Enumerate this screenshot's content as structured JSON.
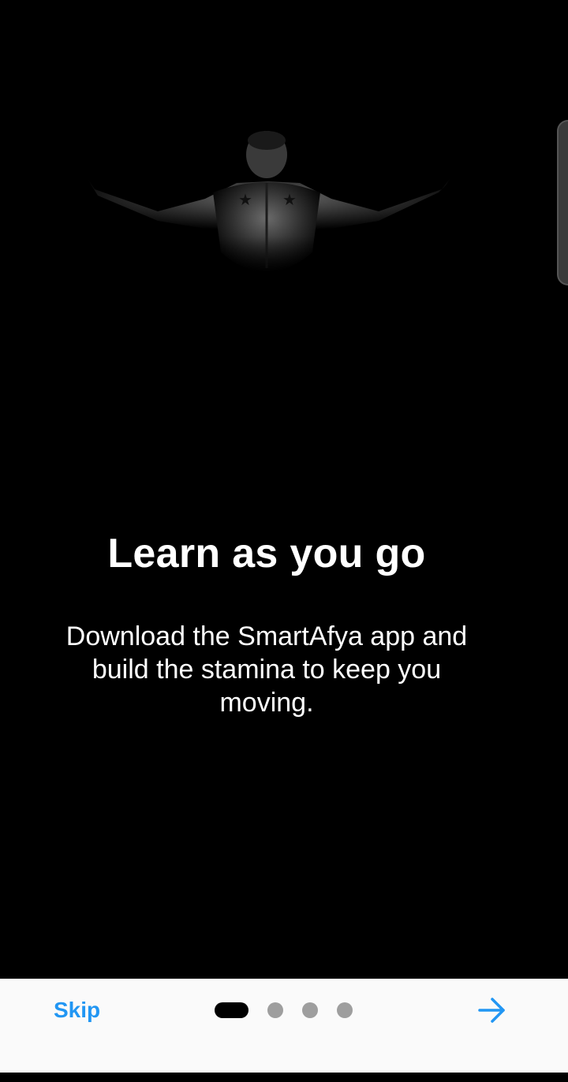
{
  "onboarding": {
    "title": "Learn as you go",
    "description": "Download the SmartAfya app and build the stamina to keep you moving.",
    "hero_image": "man-back-arms-spread-photo"
  },
  "navigation": {
    "skip_label": "Skip",
    "current_page": 1,
    "total_pages": 4,
    "next_icon": "arrow-right-icon"
  },
  "colors": {
    "background": "#000000",
    "bottom_bar": "#fafafa",
    "accent": "#2196f3",
    "dot_inactive": "#9e9e9e",
    "dot_active": "#000000"
  }
}
